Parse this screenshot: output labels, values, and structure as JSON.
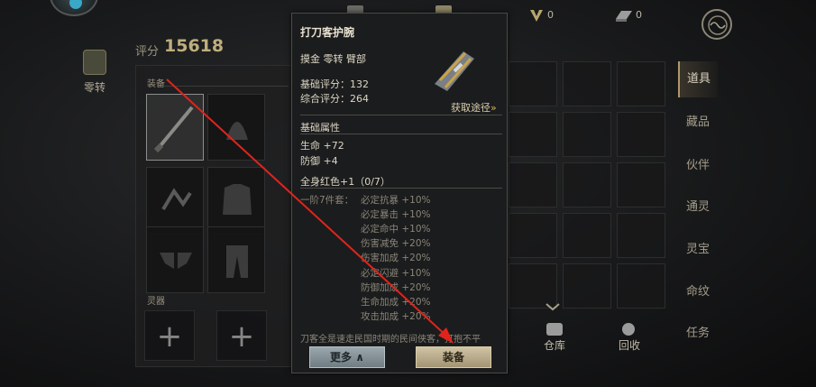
{
  "topbar": {
    "resources": [
      {
        "icon": "v-token-icon",
        "value": "0"
      },
      {
        "icon": "ingot-icon",
        "value": "0"
      }
    ]
  },
  "left": {
    "score_label": "评分",
    "score_value": "15618",
    "zero_label": "零转",
    "equip_section": "装备",
    "spirit_section": "灵器"
  },
  "right": {
    "tabs": [
      "道具",
      "藏品",
      "伙伴",
      "通灵",
      "灵宝",
      "命纹",
      "任务"
    ],
    "active_tab": 0,
    "warehouse_label": "仓库",
    "recycle_label": "回收"
  },
  "tooltip": {
    "title": "打刀客护腕",
    "tags": "摸金  零转  臂部",
    "base_score": "基础评分：132",
    "total_score": "综合评分：264",
    "source_link": "获取途径",
    "attr_header": "基础属性",
    "attrs": [
      "生命 +72",
      "防御 +4"
    ],
    "set_header": "全身红色+1（0/7）",
    "set_prefix": "一阶7件套：",
    "set_bonus": [
      "必定抗暴 +10%",
      "必定暴击 +10%",
      "必定命中 +10%",
      "伤害减免 +20%",
      "伤害加成 +20%",
      "必定闪避 +10%",
      "防御加成 +20%",
      "生命加成 +20%",
      "攻击加成 +20%"
    ],
    "desc_fragment": "刀客全是速走民国时期的民间侠客，打抱不平",
    "more_button": "更多",
    "equip_button": "装备"
  },
  "colors": {
    "accent_gold": "#d6b35a",
    "arrow_red": "#e0241c"
  }
}
